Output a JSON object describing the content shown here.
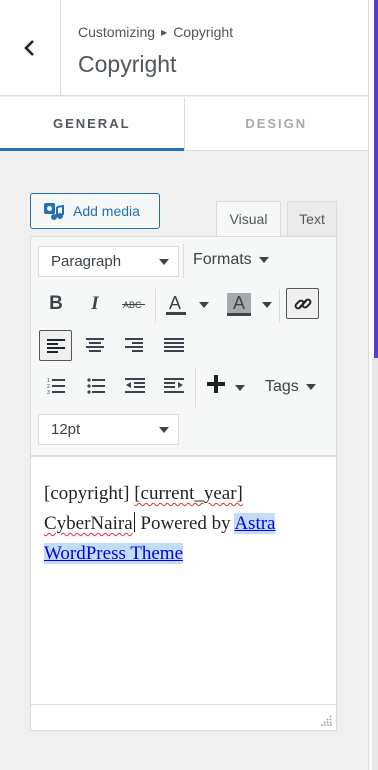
{
  "header": {
    "breadcrumb_root": "Customizing",
    "breadcrumb_current": "Copyright",
    "title": "Copyright"
  },
  "tabs": [
    {
      "label": "GENERAL",
      "active": true
    },
    {
      "label": "DESIGN",
      "active": false
    }
  ],
  "editor": {
    "add_media_label": "Add media",
    "mode_visual": "Visual",
    "mode_text": "Text",
    "active_mode": "Visual",
    "block_format": "Paragraph",
    "formats_label": "Formats",
    "font_size": "12pt",
    "insert_label": "Tags",
    "toolbar_icons": [
      "bold-icon",
      "italic-icon",
      "strikethrough-icon",
      "text-color-icon",
      "background-color-icon",
      "link-icon",
      "align-left-icon",
      "align-center-icon",
      "align-right-icon",
      "align-justify-icon",
      "ordered-list-icon",
      "bulleted-list-icon",
      "outdent-icon",
      "indent-icon",
      "insert-plus-icon"
    ],
    "content": {
      "part1": "[copyright] ",
      "year_shortcode": "[current_year]",
      "site_name": "CyberNaira",
      "powered_by": " Powered by ",
      "link_text": "Astra WordPress Theme"
    }
  },
  "colors": {
    "accent": "#2271b1",
    "side_accent": "#4f3fd6",
    "spellcheck": "#d63638"
  }
}
